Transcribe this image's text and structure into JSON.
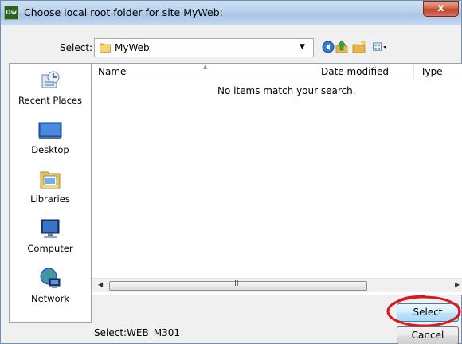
{
  "window": {
    "app_icon_text": "Dw",
    "title": "Choose local root folder for site MyWeb:",
    "close_label": "x"
  },
  "toolbar": {
    "select_label": "Select:",
    "path_value": "MyWeb",
    "icons": [
      "back-icon",
      "up-folder-icon",
      "new-folder-icon",
      "views-menu-icon"
    ]
  },
  "places": [
    {
      "label": "Recent Places",
      "icon": "recent-places-icon"
    },
    {
      "label": "Desktop",
      "icon": "desktop-icon"
    },
    {
      "label": "Libraries",
      "icon": "libraries-icon"
    },
    {
      "label": "Computer",
      "icon": "computer-icon"
    },
    {
      "label": "Network",
      "icon": "network-icon"
    }
  ],
  "file_list": {
    "columns": [
      "Name",
      "Date modified",
      "Type"
    ],
    "empty_message": "No items match your search."
  },
  "scrollbar": {
    "grip": "III"
  },
  "status": {
    "text": "Select:WEB_M301"
  },
  "buttons": {
    "select": "Select",
    "cancel": "Cancel"
  },
  "colors": {
    "highlight": "#e0151b",
    "title_gradient": "#b9d1ec",
    "close": "#c0412b"
  }
}
